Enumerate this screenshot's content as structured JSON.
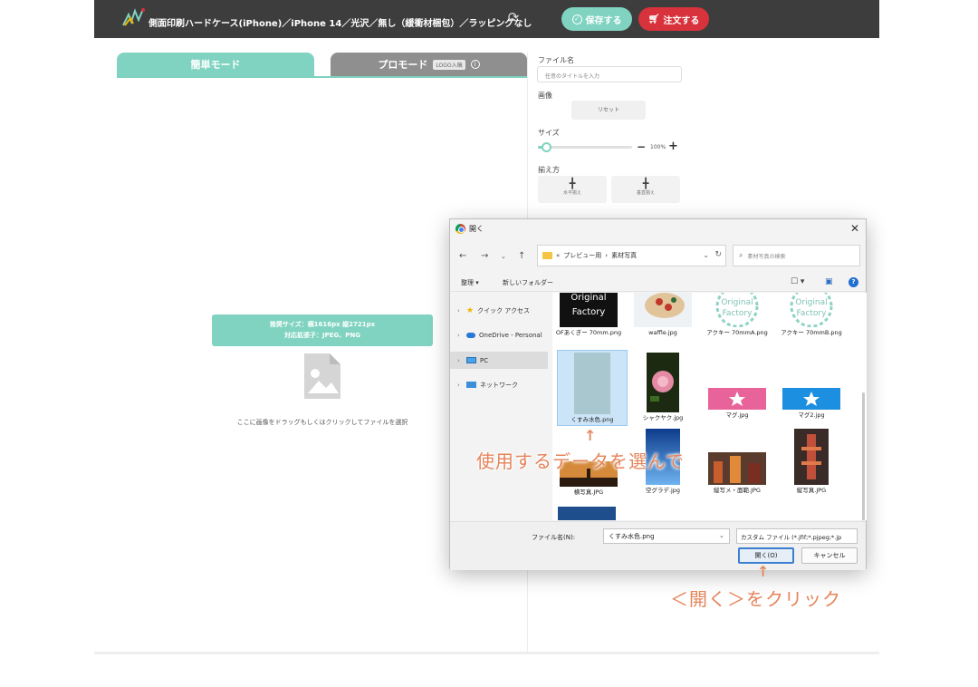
{
  "header": {
    "title": "側面印刷ハードケース(iPhone)／iPhone 14／光沢／無し（緩衝材梱包）／ラッピングなし",
    "save_label": "保存する",
    "order_label": "注文する",
    "save_icon": "check-circle-icon",
    "order_icon": "cart-icon",
    "refresh_icon": "refresh-icon"
  },
  "tabs": {
    "easy": "簡単モード",
    "pro": "プロモード",
    "pro_badge": "LOGO入稿"
  },
  "editor": {
    "recommend_line1": "推奨サイズ：横1616px 縦2721px",
    "recommend_line2": "対応拡張子：JPEG、PNG",
    "drop_text": "ここに画像をドラッグもしくはクリックしてファイルを選択"
  },
  "panel": {
    "file_name_label": "ファイル名",
    "file_name_placeholder": "任意のタイトルを入力",
    "image_label": "画像",
    "reset_label": "リセット",
    "size_label": "サイズ",
    "zoom_value": "100%",
    "slider_fraction": 0.06,
    "align_label": "揃え方",
    "align_h_label": "水平揃え",
    "align_v_label": "垂直揃え"
  },
  "dialog": {
    "title": "開く",
    "breadcrumb_parts": [
      "«",
      "プレビュー用",
      "›",
      "素材写真"
    ],
    "search_placeholder": "素材写真の検索",
    "organize_label": "整理 ▾",
    "new_folder_label": "新しいフォルダー",
    "nav_items": [
      {
        "label": "クイック アクセス",
        "icon": "star-icon"
      },
      {
        "label": "OneDrive - Personal",
        "icon": "cloud-icon"
      },
      {
        "label": "PC",
        "icon": "pc-icon"
      },
      {
        "label": "ネットワーク",
        "icon": "network-icon"
      }
    ],
    "files": [
      {
        "name": "OFあくぎー 70mm.png",
        "kind": "of-black"
      },
      {
        "name": "waffle.jpg",
        "kind": "waffle"
      },
      {
        "name": "アクキー 70mmA.png",
        "kind": "of-white"
      },
      {
        "name": "アクキー 70mmB.png",
        "kind": "of-white"
      },
      {
        "name": "くすみ水色.png",
        "kind": "pale-blue"
      },
      {
        "name": "シャクヤク.jpg",
        "kind": "flower"
      },
      {
        "name": "マグ.jpg",
        "kind": "pink-star"
      },
      {
        "name": "マグ2.jpg",
        "kind": "blue-star"
      },
      {
        "name": "横写真.JPG",
        "kind": "sunset"
      },
      {
        "name": "空グラデ.jpg",
        "kind": "sky"
      },
      {
        "name": "縦写メ・面範.JPG",
        "kind": "city"
      },
      {
        "name": "縦写真.JPG",
        "kind": "tower"
      }
    ],
    "filename_label": "ファイル名(N):",
    "filename_value": "くすみ水色.png",
    "filetype_value": "カスタム ファイル (*.jfif;*.pjpeg;*.jp",
    "open_label": "開く(O)",
    "cancel_label": "キャンセル"
  },
  "annotations": {
    "select_text": "使用するデータを選んで",
    "click_text": "＜開く＞をクリック"
  },
  "colors": {
    "accent": "#7fd3c0",
    "order_red": "#d8323c",
    "header_bg": "#3d3d3d",
    "annotation": "#e5845a"
  }
}
